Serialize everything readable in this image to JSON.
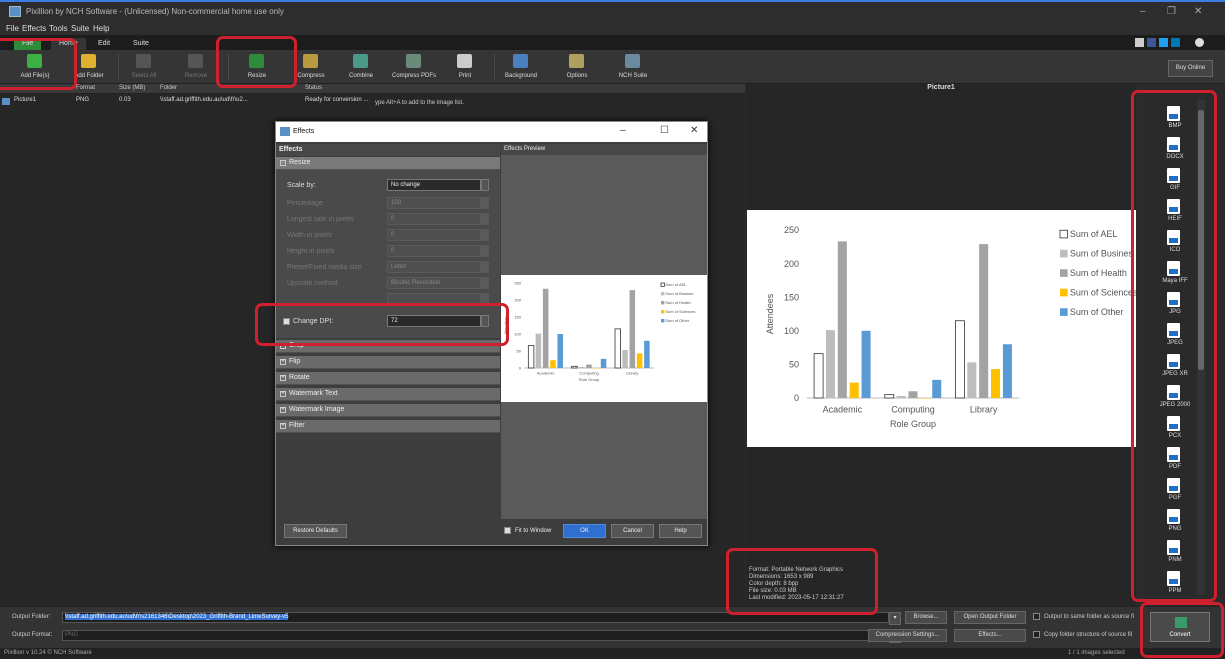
{
  "app": {
    "title": "Pixillion by NCH Software - (Unlicensed) Non-commercial home use only"
  },
  "menu": [
    "File",
    "Effects",
    "Tools",
    "Suite",
    "Help"
  ],
  "ribbon_tabs": [
    "File",
    "Home",
    "Edit",
    "Suite"
  ],
  "ribbon": {
    "add_files": "Add File(s)",
    "add_folder": "Add Folder",
    "select_all": "Select All",
    "remove": "Remove",
    "resize": "Resize",
    "compress": "Compress",
    "combine": "Combine",
    "compress_pdfs": "Compress PDFs",
    "print": "Print",
    "background": "Background",
    "options": "Options",
    "nch_suite": "NCH Suite"
  },
  "buy_online": "Buy Online",
  "file_list": {
    "columns": [
      "Format",
      "Size (MB)",
      "Folder",
      "Status"
    ],
    "rows": [
      {
        "name": "Picture1",
        "format": "PNG",
        "size": "0.03",
        "folder": "\\\\staff.ad.griffith.edu.au\\ud\\fr\\u2...",
        "status": "Ready for conversion ..."
      }
    ],
    "hint": "ype Alt+A to add to the image list."
  },
  "preview": {
    "title": "Picture1"
  },
  "file_info": {
    "format": "Format: Portable Network Graphics",
    "dimensions": "Dimensions: 1653 x 989",
    "color_depth": "Color depth: 8 bpp",
    "file_size": "File size: 0.03 MB",
    "last_modified": "Last modified: 2023-05-17 12:31:27"
  },
  "formats": [
    "BMP",
    "DOCX",
    "GIF",
    "HEIF",
    "ICO",
    "Maya IFF",
    "JPG",
    "JPEG",
    "JPEG XR",
    "JPEG 2000",
    "PCX",
    "PDF",
    "PGF",
    "PNG",
    "PNM",
    "PPM"
  ],
  "bottom": {
    "output_folder_label": "Output Folder:",
    "output_folder_value": "\\\\staff.ad.griffith.edu.au\\ud\\fr\\s2161346\\Desktop\\2023_Griffith-Brand_LimeSurvey-v5",
    "output_format_label": "Output Format:",
    "output_format_value": "PNG",
    "browse": "Browse...",
    "open_output_folder": "Open Output Folder",
    "compression_settings": "Compression Settings...",
    "effects": "Effects...",
    "same_folder": "Output to same folder as source fi",
    "copy_structure": "Copy folder structure of source fil",
    "convert": "Convert"
  },
  "status": {
    "version": "Pixillion v 10.24 © NCH Software",
    "selected": "1 / 1 images selected"
  },
  "dialog": {
    "title": "Effects",
    "effects_header": "Effects",
    "preview_header": "Effects Preview",
    "resize_group": "Resize",
    "fields": [
      {
        "label": "Scale by:",
        "value": "No change"
      },
      {
        "label": "Percentage",
        "value": "100"
      },
      {
        "label": "Longest side in pixels",
        "value": "0"
      },
      {
        "label": "Width in pixels",
        "value": "0"
      },
      {
        "label": "Height in pixels",
        "value": "0"
      },
      {
        "label": "Preset/Fixed media size",
        "value": "Letter"
      },
      {
        "label": "Upscale method",
        "value": "Bicubic Resolution"
      },
      {
        "label": "",
        "value": ""
      },
      {
        "label": "Change DPI:",
        "value": "72"
      }
    ],
    "groups": [
      "Crop",
      "Flip",
      "Rotate",
      "Watermark Text",
      "Watermark Image",
      "Filter"
    ],
    "restore_defaults": "Restore Defaults",
    "fit_to_window": "Fit to Window",
    "ok": "OK",
    "cancel": "Cancel",
    "help": "Help"
  },
  "chart_data": {
    "type": "bar",
    "categories": [
      "Academic",
      "Computing",
      "Library"
    ],
    "series": [
      {
        "name": "Sum of AEL",
        "values": [
          66,
          5,
          115
        ],
        "color": "#ffffff"
      },
      {
        "name": "Sum of Business",
        "values": [
          101,
          3,
          53
        ],
        "color": "#bdbdbd"
      },
      {
        "name": "Sum of Health",
        "values": [
          233,
          10,
          229
        ],
        "color": "#a3a3a3"
      },
      {
        "name": "Sum of Sciences",
        "values": [
          23,
          0,
          43
        ],
        "color": "#ffc000"
      },
      {
        "name": "Sum of Other",
        "values": [
          100,
          27,
          80
        ],
        "color": "#5b9bd5"
      }
    ],
    "yticks": [
      "0",
      "50",
      "100",
      "150",
      "200",
      "250"
    ],
    "ylim": [
      0,
      250
    ],
    "xlabel": "Role Group",
    "ylabel": "Attendees",
    "legend_labels": [
      "Sum of AEL",
      "Sum of Busines",
      "Sum of Health",
      "Sum of Sciences",
      "Sum of Other"
    ],
    "legend": "right"
  }
}
